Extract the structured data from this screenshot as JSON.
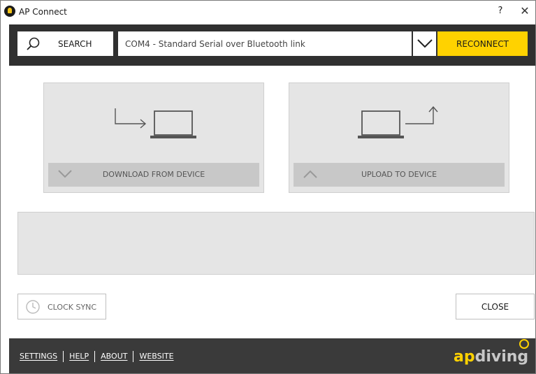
{
  "window": {
    "title": "AP Connect",
    "help_label": "?",
    "close_glyph": "✕"
  },
  "toolbar": {
    "search_label": "SEARCH",
    "port_value": "COM4 - Standard Serial over Bluetooth link",
    "reconnect_label": "RECONNECT",
    "accent": "#ffd200"
  },
  "actions": {
    "download_label": "DOWNLOAD FROM DEVICE",
    "upload_label": "UPLOAD TO DEVICE"
  },
  "buttons": {
    "clock_sync_label": "CLOCK SYNC",
    "close_label": "CLOSE"
  },
  "footer": {
    "links": [
      "SETTINGS",
      "HELP",
      "ABOUT",
      "WEBSITE"
    ],
    "brand_ap": "ap",
    "brand_diving": "diving"
  },
  "icons": {
    "search": "search-icon",
    "dropdown": "chevron-down-icon",
    "download": "download-to-laptop-icon",
    "upload": "upload-from-laptop-icon",
    "clock": "clock-icon"
  }
}
